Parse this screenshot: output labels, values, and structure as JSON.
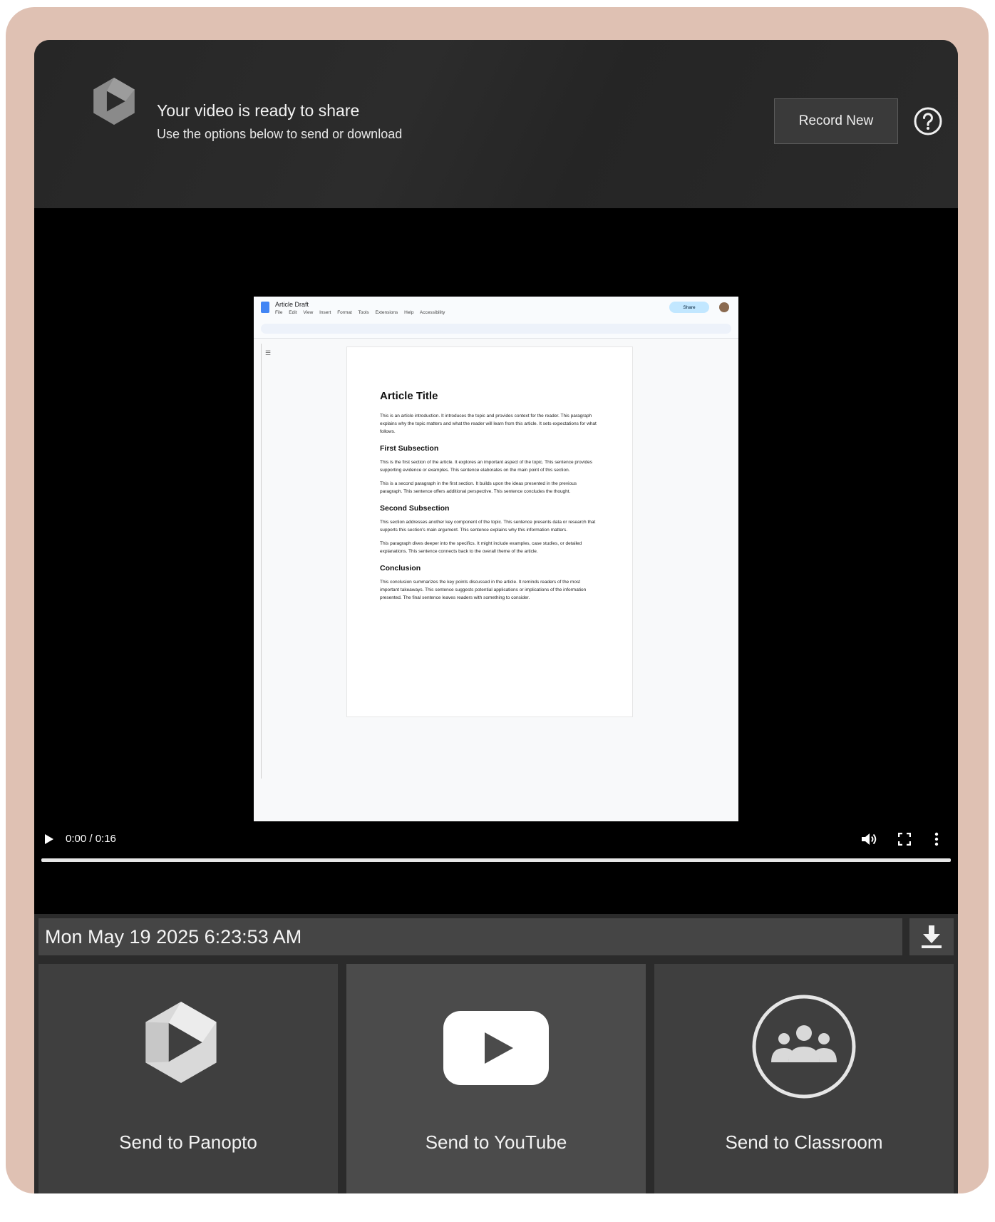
{
  "header": {
    "title": "Your video is ready to share",
    "subtitle": "Use the options below to send or download",
    "record_button": "Record New",
    "help_icon": "help-circle-icon"
  },
  "preview": {
    "doc_name": "Article Draft",
    "menu": [
      "File",
      "Edit",
      "View",
      "Insert",
      "Format",
      "Tools",
      "Extensions",
      "Help",
      "Accessibility"
    ],
    "share_label": "Share",
    "article_title": "Article Title",
    "intro": "This is an article introduction. It introduces the topic and provides context for the reader. This paragraph explains why the topic matters and what the reader will learn from this article. It sets expectations for what follows.",
    "section1_heading": "First Subsection",
    "section1_p1": "This is the first section of the article. It explores an important aspect of the topic. This sentence provides supporting evidence or examples. This sentence elaborates on the main point of this section.",
    "section1_p2": "This is a second paragraph in the first section. It builds upon the ideas presented in the previous paragraph. This sentence offers additional perspective. This sentence concludes the thought.",
    "section2_heading": "Second Subsection",
    "section2_p1": "This section addresses another key component of the topic. This sentence presents data or research that supports this section's main argument. This sentence explains why this information matters.",
    "section2_p2": "This paragraph dives deeper into the specifics. It might include examples, case studies, or detailed explanations. This sentence connects back to the overall theme of the article.",
    "conclusion_heading": "Conclusion",
    "conclusion_p": "This conclusion summarizes the key points discussed in the article. It reminds readers of the most important takeaways. This sentence suggests potential applications or implications of the information presented. The final sentence leaves readers with something to consider."
  },
  "player": {
    "time": "0:00 / 0:16",
    "progress": 0
  },
  "recording": {
    "name": "Mon May 19 2025 6:23:53 AM",
    "download_icon": "download-icon"
  },
  "share_options": [
    {
      "label": "Send to Panopto",
      "icon": "panopto-icon"
    },
    {
      "label": "Send to YouTube",
      "icon": "youtube-icon"
    },
    {
      "label": "Send to Classroom",
      "icon": "classroom-icon"
    }
  ]
}
